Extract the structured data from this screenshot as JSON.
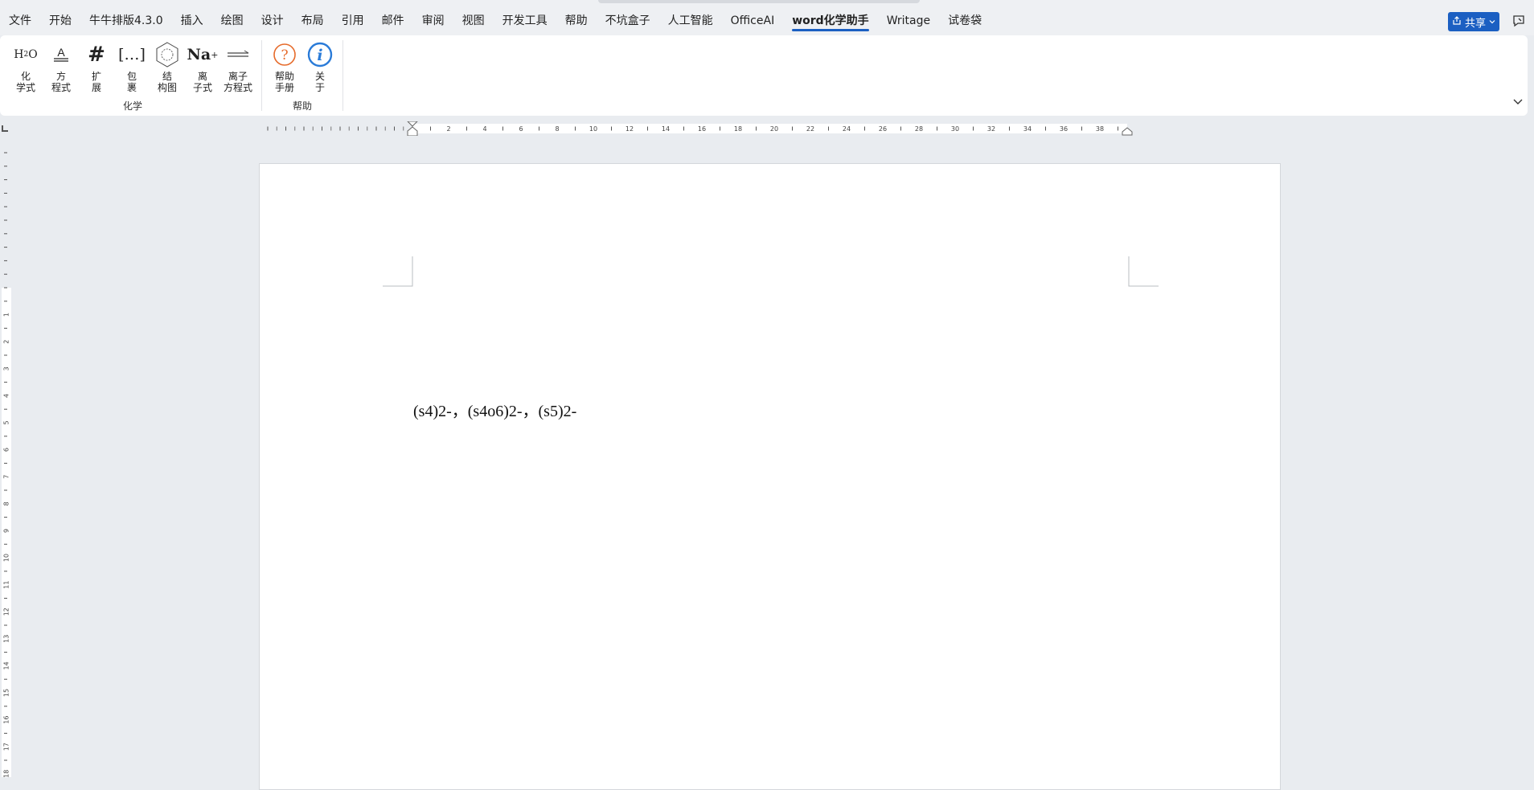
{
  "menu": {
    "tabs": [
      {
        "label": "文件"
      },
      {
        "label": "开始"
      },
      {
        "label": "牛牛排版4.3.0"
      },
      {
        "label": "插入"
      },
      {
        "label": "绘图"
      },
      {
        "label": "设计"
      },
      {
        "label": "布局"
      },
      {
        "label": "引用"
      },
      {
        "label": "邮件"
      },
      {
        "label": "审阅"
      },
      {
        "label": "视图"
      },
      {
        "label": "开发工具"
      },
      {
        "label": "帮助"
      },
      {
        "label": "不坑盒子"
      },
      {
        "label": "人工智能"
      },
      {
        "label": "OfficeAI"
      },
      {
        "label": "word化学助手",
        "active": true
      },
      {
        "label": "Writage"
      },
      {
        "label": "试卷袋"
      }
    ],
    "share_label": "共享"
  },
  "ribbon": {
    "groups": [
      {
        "label": "化学",
        "buttons": [
          {
            "icon": "h2o-icon",
            "icon_text": "H",
            "icon_sub": "2",
            "icon_tail": "O",
            "line1": "化",
            "line2": "学式"
          },
          {
            "icon": "equation-icon",
            "icon_text": "A",
            "line1": "方",
            "line2": "程式"
          },
          {
            "icon": "hash-icon",
            "icon_text": "#",
            "line1": "扩",
            "line2": "展"
          },
          {
            "icon": "brackets-icon",
            "icon_text": "[…]",
            "line1": "包",
            "line2": "裹"
          },
          {
            "icon": "benzene-icon",
            "line1": "结",
            "line2": "构图"
          },
          {
            "icon": "ion-icon",
            "icon_text": "Na",
            "icon_sup": "+",
            "line1": "离",
            "line2": "子式"
          },
          {
            "icon": "ion-equation-icon",
            "line1": "离子",
            "line2": "方程式"
          }
        ]
      },
      {
        "label": "帮助",
        "buttons": [
          {
            "icon": "help-icon",
            "icon_text": "?",
            "line1": "帮助",
            "line2": "手册"
          },
          {
            "icon": "info-icon",
            "icon_text": "i",
            "line1": "关",
            "line2": "于"
          }
        ]
      }
    ]
  },
  "ruler": {
    "h_numbers": [
      "2",
      "4",
      "6",
      "8",
      "10",
      "12",
      "14",
      "16",
      "18",
      "20",
      "22",
      "24",
      "26",
      "28",
      "30",
      "32",
      "34",
      "36",
      "38"
    ],
    "v_numbers": [
      "1",
      "2",
      "3",
      "4",
      "5",
      "6",
      "7",
      "8",
      "9",
      "10",
      "11",
      "12",
      "13",
      "14",
      "15",
      "16",
      "17",
      "18"
    ]
  },
  "document": {
    "text": "(s4)2-，(s4o6)2-，(s5)2-"
  }
}
